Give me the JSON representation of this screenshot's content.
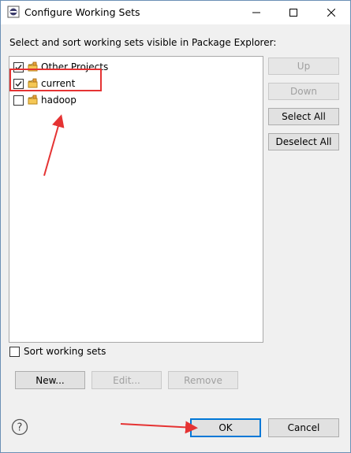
{
  "window": {
    "title": "Configure Working Sets"
  },
  "instruction": "Select and sort working sets visible in Package Explorer:",
  "working_sets": [
    {
      "label": "Other Projects",
      "checked": true
    },
    {
      "label": "current",
      "checked": true
    },
    {
      "label": "hadoop",
      "checked": false
    }
  ],
  "side_buttons": {
    "up": "Up",
    "down": "Down",
    "select_all": "Select All",
    "deselect_all": "Deselect All"
  },
  "sort_checkbox": {
    "label": "Sort working sets",
    "checked": false
  },
  "bottom_buttons": {
    "new": "New...",
    "edit": "Edit...",
    "remove": "Remove"
  },
  "dialog_buttons": {
    "ok": "OK",
    "cancel": "Cancel"
  },
  "annotation_color": "#e53333"
}
